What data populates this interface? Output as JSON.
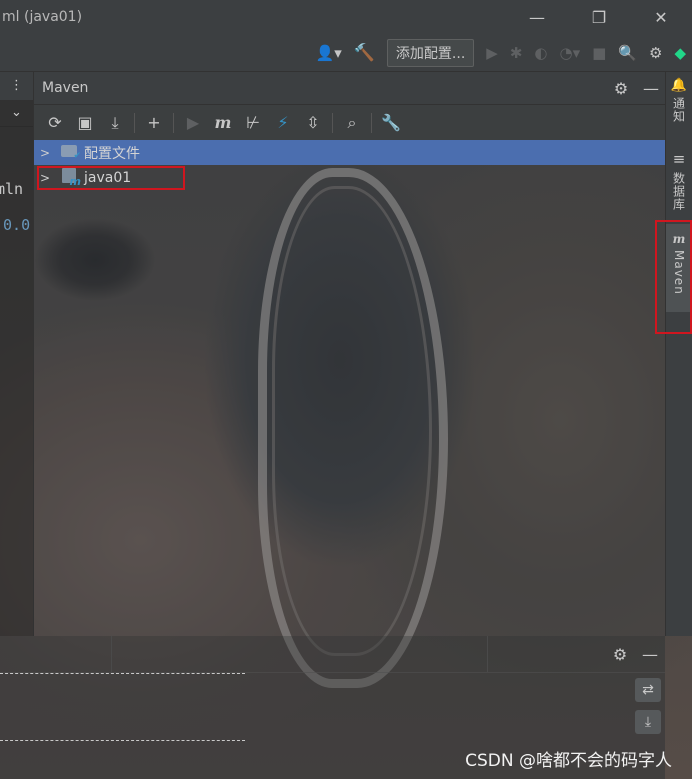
{
  "window": {
    "title": "ml (java01)",
    "minimize": "—",
    "maximize": "❐",
    "close": "✕"
  },
  "toolbar": {
    "user_icon": "👤▾",
    "build_icon": "🔨",
    "add_config_label": "添加配置...",
    "run_icon": "▶",
    "debug_icon": "✱",
    "coverage_icon": "◐",
    "profile_icon": "◔▾",
    "stop_icon": "■",
    "search_icon": "🔍",
    "settings_icon": "⚙",
    "toolbox_icon": "◆"
  },
  "left_strip": {
    "menu_icon": "⋮",
    "chevron_icon": "⌄",
    "code_line1": "mln",
    "code_line2": ".0.0"
  },
  "maven": {
    "title": "Maven",
    "settings_icon": "⚙",
    "hide_icon": "—",
    "tools": {
      "reload": "⟳",
      "generate_sources": "▣",
      "download": "⤓",
      "add": "+",
      "run": "▶",
      "execute_goal": "m",
      "skip_tests": "⊬",
      "offline": "⚡",
      "collapse": "⇳",
      "analyze": "⌕",
      "settings": "🔧"
    },
    "tree": [
      {
        "label": "配置文件",
        "selected": true,
        "icon": "folder-config-icon"
      },
      {
        "label": "java01",
        "selected": false,
        "icon": "maven-module-icon"
      }
    ]
  },
  "right_stripe": {
    "notifications_label": "通知",
    "database_label": "数据库",
    "maven_label": "Maven",
    "notifications_icon": "🔔",
    "database_icon": "≡",
    "maven_icon": "m"
  },
  "bottom": {
    "settings_icon": "⚙",
    "hide_icon": "—",
    "wrap_icon": "⇄",
    "scroll_end_icon": "⤓"
  },
  "watermark": "CSDN @啥都不会的码字人"
}
